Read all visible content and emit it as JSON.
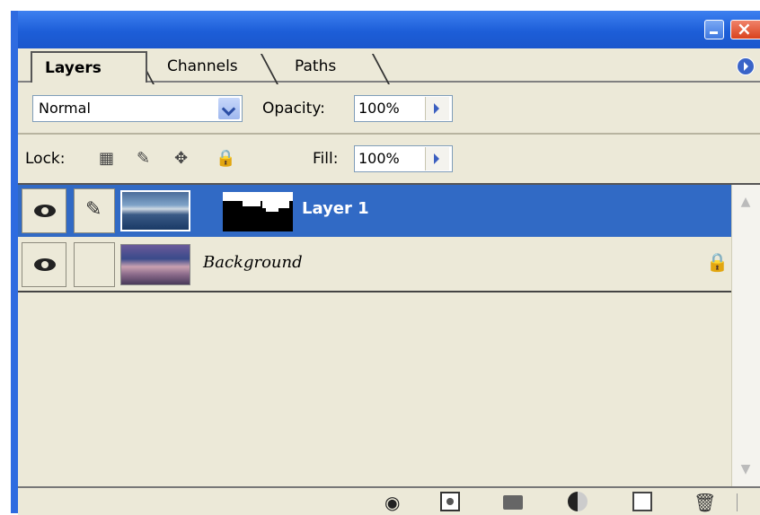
{
  "tabs": [
    {
      "label": "Layers",
      "active": true
    },
    {
      "label": "Channels",
      "active": false
    },
    {
      "label": "Paths",
      "active": false
    }
  ],
  "blend_mode": {
    "value": "Normal"
  },
  "opacity": {
    "label": "Opacity:",
    "value": "100%"
  },
  "lock": {
    "label": "Lock:",
    "icons": [
      "lock-transparent-icon",
      "lock-image-icon",
      "lock-position-icon",
      "lock-all-icon"
    ]
  },
  "fill": {
    "label": "Fill:",
    "value": "100%"
  },
  "layers": [
    {
      "name": "Layer 1",
      "selected": true,
      "visible": true,
      "has_mask": true
    },
    {
      "name": "Background",
      "selected": false,
      "visible": true,
      "locked": true
    }
  ],
  "bottom_icons": [
    "link-layers-icon",
    "add-layer-mask-icon",
    "new-group-icon",
    "new-adjustment-layer-icon",
    "new-layer-icon",
    "delete-layer-icon"
  ],
  "colors": {
    "title_bar": "#1d5ed8",
    "selection": "#316ac5",
    "panel": "#ece9d8"
  }
}
